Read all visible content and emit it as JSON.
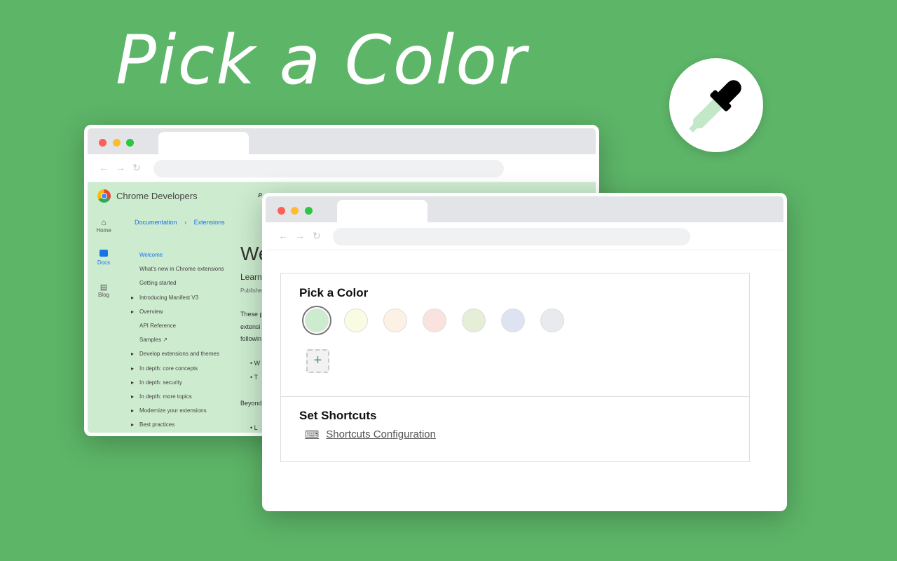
{
  "hero_title": "Pick a Color",
  "colors": {
    "background": "#5db568",
    "accent_green": "#cdeccf"
  },
  "badge": {
    "icon": "eyedropper-icon"
  },
  "back_window": {
    "site_name": "Chrome Developers",
    "rail": [
      {
        "icon": "home-icon",
        "label": "Home"
      },
      {
        "icon": "docs-icon",
        "label": "Docs"
      },
      {
        "icon": "blog-icon",
        "label": "Blog"
      }
    ],
    "breadcrumb": [
      "Documentation",
      "Extensions"
    ],
    "toc": [
      {
        "label": "Welcome",
        "active": true
      },
      {
        "label": "What's new in Chrome extensions"
      },
      {
        "label": "Getting started"
      },
      {
        "label": "Introducing Manifest V3",
        "expandable": true
      },
      {
        "label": "Overview",
        "expandable": true
      },
      {
        "label": "API Reference"
      },
      {
        "label": "Samples ↗"
      },
      {
        "label": "Develop extensions and themes",
        "expandable": true
      },
      {
        "label": "In depth: core concepts",
        "expandable": true
      },
      {
        "label": "In depth: security",
        "expandable": true
      },
      {
        "label": "In depth: more topics",
        "expandable": true
      },
      {
        "label": "Modernize your extensions",
        "expandable": true
      },
      {
        "label": "Best practices",
        "expandable": true
      }
    ],
    "main": {
      "heading": "We",
      "sub": "Learn",
      "published": "Publishe",
      "p1": "These p",
      "p2": "extensi",
      "p3": "followin",
      "b1": "W",
      "b2": "T",
      "p4": "Beyond",
      "b3": "L"
    }
  },
  "popup": {
    "pick_title": "Pick a Color",
    "swatches": [
      {
        "color": "#cdeccf",
        "selected": true
      },
      {
        "color": "#fafbe3"
      },
      {
        "color": "#fdf1e6"
      },
      {
        "color": "#fae3de"
      },
      {
        "color": "#e5eed6"
      },
      {
        "color": "#dde3f1"
      },
      {
        "color": "#e9eaed"
      }
    ],
    "add_label": "+",
    "shortcuts_title": "Set Shortcuts",
    "shortcuts_link": "Shortcuts Configuration"
  }
}
